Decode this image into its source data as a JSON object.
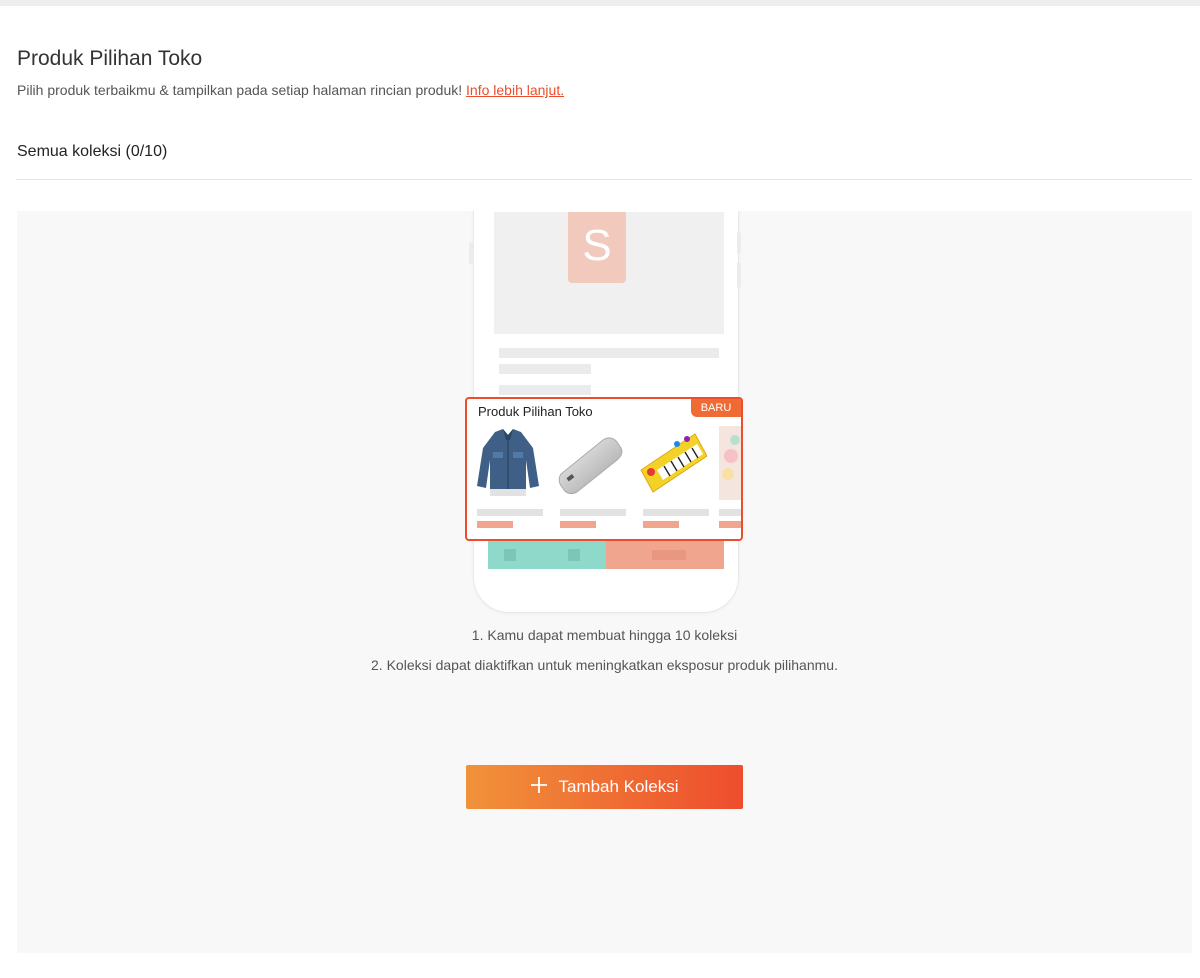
{
  "header": {
    "title": "Produk Pilihan Toko",
    "subtitle": "Pilih produk terbaikmu & tampilkan pada setiap halaman rincian produk!",
    "info_link": "Info lebih lanjut."
  },
  "section": {
    "label": "Semua koleksi (0/10)"
  },
  "illustration": {
    "logo_letter": "S",
    "card_title": "Produk Pilihan Toko",
    "badge": "BARU",
    "products": [
      "jacket-image",
      "powerbank-image",
      "piano-mat-image",
      "toy-image"
    ]
  },
  "instructions": [
    "1. Kamu dapat membuat hingga 10 koleksi",
    "2. Koleksi dapat diaktifkan untuk meningkatkan eksposur produk pilihanmu."
  ],
  "add_button": {
    "icon": "plus-icon",
    "label": "Tambah Koleksi"
  },
  "colors": {
    "accent": "#ee4d2d",
    "gradient_start": "#f0923a",
    "panel_bg": "#f8f8f8"
  }
}
